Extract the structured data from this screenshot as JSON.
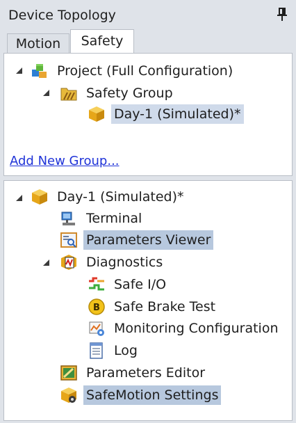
{
  "panel": {
    "title": "Device Topology"
  },
  "tabs": [
    {
      "label": "Motion",
      "active": false
    },
    {
      "label": "Safety",
      "active": true
    }
  ],
  "safety_tree": {
    "project": "Project (Full Configuration)",
    "group": "Safety Group",
    "device": "Day-1 (Simulated)*",
    "add_link": "Add New Group..."
  },
  "device_tree": {
    "root": "Day-1 (Simulated)*",
    "terminal": "Terminal",
    "parameters_viewer": "Parameters Viewer",
    "diagnostics": "Diagnostics",
    "safe_io": "Safe I/O",
    "safe_brake_test": "Safe Brake Test",
    "monitoring_configuration": "Monitoring Configuration",
    "log": "Log",
    "parameters_editor": "Parameters Editor",
    "safemotion_settings": "SafeMotion Settings"
  },
  "colors": {
    "background": "#dfe3e9",
    "selection": "#b7c8de",
    "link": "#1f33d8"
  },
  "icons": {
    "pin": "pin-icon",
    "project": "project-icon",
    "group": "safety-group-icon",
    "device": "device-cube-icon",
    "terminal": "terminal-icon",
    "viewer": "parameters-viewer-icon",
    "diagnostics": "diagnostics-icon",
    "safe_io": "safe-io-icon",
    "brake": "safe-brake-icon",
    "monitoring": "monitoring-icon",
    "log": "log-icon",
    "editor": "parameters-editor-icon",
    "settings": "safemotion-settings-icon"
  }
}
